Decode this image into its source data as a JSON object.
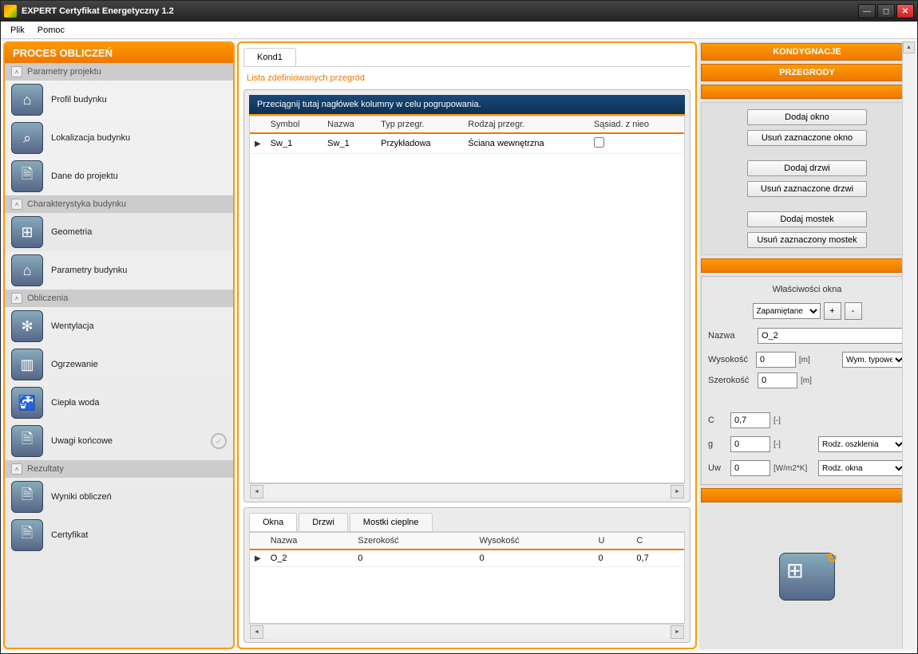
{
  "window": {
    "title": "EXPERT Certyfikat Energetyczny 1.2"
  },
  "menu": {
    "file": "Plik",
    "help": "Pomoc"
  },
  "sidebar": {
    "title": "PROCES OBLICZEŃ",
    "sections": [
      {
        "label": "Parametry projektu",
        "items": [
          {
            "label": "Profil budynku"
          },
          {
            "label": "Lokalizacja budynku"
          },
          {
            "label": "Dane do projektu"
          }
        ]
      },
      {
        "label": "Charakterystyka budynku",
        "items": [
          {
            "label": "Geometria",
            "selected": true
          },
          {
            "label": "Parametry budynku"
          }
        ]
      },
      {
        "label": "Obliczenia",
        "items": [
          {
            "label": "Wentylacja"
          },
          {
            "label": "Ogrzewanie"
          },
          {
            "label": "Ciepła woda"
          },
          {
            "label": "Uwagi końcowe",
            "check": true
          }
        ]
      },
      {
        "label": "Rezultaty",
        "items": [
          {
            "label": "Wyniki obliczeń"
          },
          {
            "label": "Certyfikat"
          }
        ]
      }
    ],
    "icons": [
      "⌂",
      "⌕",
      "🗎",
      "⊞",
      "⌂",
      "✻",
      "▥",
      "🚰",
      "🗎",
      "🗎",
      "🗎"
    ]
  },
  "main": {
    "tab": "Kond1",
    "caption": "Lista zdefiniowanych przegród",
    "groupBarText": "Przeciągnij tutaj nagłówek kolumny w celu pogrupowania.",
    "grid": {
      "columns": [
        "Symbol",
        "Nazwa",
        "Typ przegr.",
        "Rodzaj przegr.",
        "Sąsiad. z nieo"
      ],
      "rows": [
        {
          "symbol": "Sw_1",
          "nazwa": "Sw_1",
          "typ": "Przykładowa",
          "rodzaj": "Ściana wewnętrzna",
          "sasiad": false
        }
      ]
    },
    "subTabs": [
      "Okna",
      "Drzwi",
      "Mostki cieplne"
    ],
    "subGrid": {
      "columns": [
        "Nazwa",
        "Szerokość",
        "Wysokość",
        "U",
        "C"
      ],
      "rows": [
        {
          "nazwa": "O_2",
          "szer": "0",
          "wys": "0",
          "u": "0",
          "c": "0,7"
        }
      ]
    }
  },
  "right": {
    "header1": "KONDYGNACJE",
    "header2": "PRZEGRODY",
    "buttons": {
      "addWindow": "Dodaj okno",
      "delWindow": "Usuń zaznaczone okno",
      "addDoor": "Dodaj drzwi",
      "delDoor": "Usuń zaznaczone drzwi",
      "addBridge": "Dodaj mostek",
      "delBridge": "Usuń zaznaczony mostek"
    },
    "props": {
      "title": "Właściwości okna",
      "memorized": "Zapamiętane",
      "nameLabel": "Nazwa",
      "nameValue": "O_2",
      "heightLabel": "Wysokość",
      "heightValue": "0",
      "heightUnit": "[m]",
      "widthLabel": "Szerokość",
      "widthValue": "0",
      "widthUnit": "[m]",
      "dimTypical": "Wym. typowe",
      "cLabel": "C",
      "cValue": "0,7",
      "cUnit": "[-]",
      "gLabel": "g",
      "gValue": "0",
      "gUnit": "[-]",
      "glazingType": "Rodz. oszklenia",
      "uwLabel": "Uw",
      "uwValue": "0",
      "uwUnit": "[W/m2*K]",
      "windowType": "Rodz. okna"
    }
  }
}
